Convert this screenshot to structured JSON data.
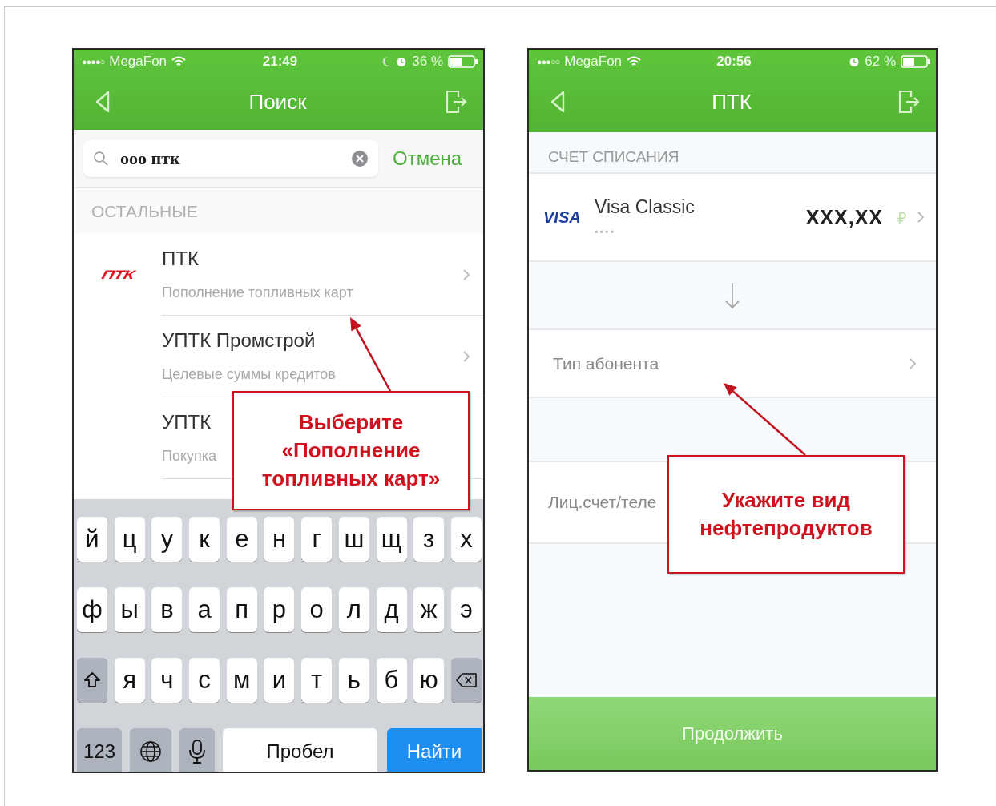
{
  "left_screen": {
    "status_bar": {
      "signal": "●●●●○",
      "carrier": "MegaFon",
      "time": "21:49",
      "icons": [
        {
          "kind": "moon"
        },
        {
          "kind": "alarm"
        }
      ],
      "battery": "36 %"
    },
    "nav": {
      "title": "Поиск"
    },
    "search": {
      "value": "ооо птк",
      "cancel": "Отмена"
    },
    "section": "ОСТАЛЬНЫЕ",
    "results": [
      {
        "logo": "ПТК",
        "title": "ПТК",
        "subtitle": "Пополнение топливных карт",
        "chevron": true
      },
      {
        "title": "УПТК Промстрой",
        "subtitle": "Целевые суммы кредитов",
        "chevron": true
      },
      {
        "title": "УПТК",
        "subtitle": "Покупка",
        "chevron": false
      }
    ],
    "keyboard": {
      "rows": [
        [
          "й",
          "ц",
          "у",
          "к",
          "е",
          "н",
          "г",
          "ш",
          "щ",
          "з",
          "х"
        ],
        [
          "ф",
          "ы",
          "в",
          "а",
          "п",
          "р",
          "о",
          "л",
          "д",
          "ж",
          "э"
        ],
        [
          {
            "kind": "shift"
          },
          "я",
          "ч",
          "с",
          "м",
          "и",
          "т",
          "ь",
          "б",
          "ю",
          {
            "kind": "backspace"
          }
        ]
      ],
      "bottom": [
        {
          "kind": "numbers",
          "label": "123"
        },
        {
          "kind": "globe"
        },
        {
          "kind": "mic"
        },
        {
          "kind": "space",
          "label": "Пробел"
        },
        {
          "kind": "action",
          "label": "Найти"
        }
      ]
    }
  },
  "right_screen": {
    "status_bar": {
      "signal": "●●●○○",
      "carrier": "MegaFon",
      "time": "20:56",
      "icons": [
        {
          "kind": "alarm"
        }
      ],
      "battery": "62 %"
    },
    "nav": {
      "title": "ПТК"
    },
    "section": "СЧЕТ СПИСАНИЯ",
    "card": {
      "brand": "VISA",
      "name": "Visa Classic",
      "number": "••••",
      "amount": "XXX,XX",
      "currency": "₽"
    },
    "fields": [
      {
        "label": "Тип абонента",
        "chevron": true
      },
      {
        "label": "Лиц.счет/теле",
        "chevron": false
      }
    ],
    "continue_button": {
      "label": "Продолжить",
      "disabled": true
    }
  },
  "callouts": [
    {
      "text": "Выберите «Пополнение топливных карт»"
    },
    {
      "text": "Укажите вид нефтепродуктов"
    }
  ]
}
